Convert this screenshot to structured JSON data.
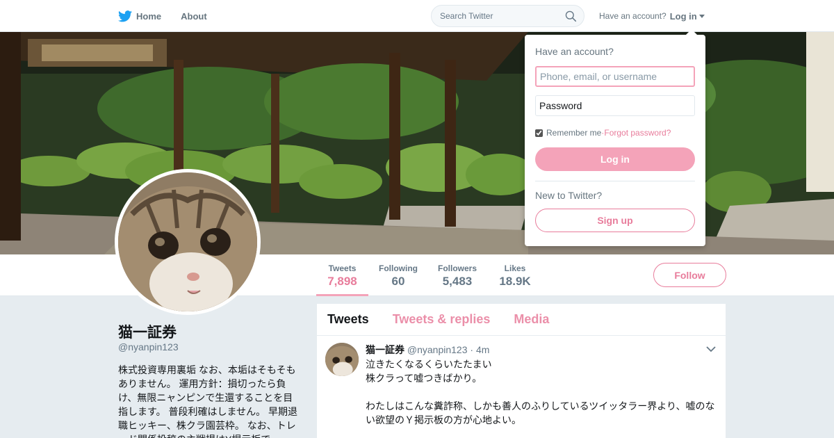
{
  "nav": {
    "home_label": "Home",
    "about_label": "About",
    "search_placeholder": "Search Twitter",
    "have_account": "Have an account?",
    "login_label": "Log in"
  },
  "profile": {
    "name": "猫一証券",
    "handle": "@nyanpin123",
    "bio": "株式投資専用裏垢 なお、本垢はそもそもありません。 運用方針：損切ったら負け、無限ニャンピンで生還することを目指します。 普段利確はしません。 早期退職ヒッキー、株クラ園芸枠。 なお、トレード関係投稿の主戦場はY掲示板で。"
  },
  "stats": [
    {
      "label": "Tweets",
      "value": "7,898"
    },
    {
      "label": "Following",
      "value": "60"
    },
    {
      "label": "Followers",
      "value": "5,483"
    },
    {
      "label": "Likes",
      "value": "18.9K"
    }
  ],
  "follow_label": "Follow",
  "tabs": [
    "Tweets",
    "Tweets & replies",
    "Media"
  ],
  "tweet": {
    "name": "猫一証券",
    "handle": "@nyanpin123",
    "time": "4m",
    "lines": [
      "泣きたくなるくらいたたまい",
      "株クラって嘘つきばかり。",
      "",
      "わたしはこんな糞詐称、しかも善人のふりしているツイッタラー界より、嘘のない欲望のＹ掲示板の方が心地よい。"
    ]
  },
  "login_dropdown": {
    "title": "Have an account?",
    "username_placeholder": "Phone, email, or username",
    "password_placeholder": "Password",
    "remember_label": "Remember me",
    "separator": " · ",
    "forgot_label": "Forgot password?",
    "login_button": "Log in",
    "new_label": "New to Twitter?",
    "signup_button": "Sign up"
  },
  "colors": {
    "accent": "#e87c9b",
    "accent_light": "#f4a3b9",
    "twitter_blue": "#1da1f2"
  }
}
